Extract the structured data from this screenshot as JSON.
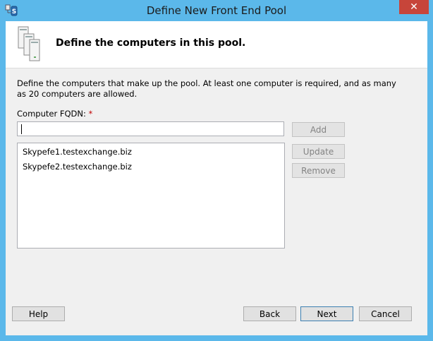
{
  "window": {
    "title": "Define New Front End Pool",
    "close_glyph": "✕"
  },
  "header": {
    "title": "Define the computers in this pool."
  },
  "body": {
    "description": "Define the computers that make up the pool. At least one computer is required, and as many as 20 computers are allowed.",
    "fqdn_label": "Computer FQDN:",
    "required_marker": "*",
    "fqdn_value": ""
  },
  "computers": [
    "Skypefe1.testexchange.biz",
    "Skypefe2.testexchange.biz"
  ],
  "buttons": {
    "add": "Add",
    "update": "Update",
    "remove": "Remove",
    "help": "Help",
    "back": "Back",
    "next": "Next",
    "cancel": "Cancel"
  },
  "colors": {
    "titlebar": "#5bb8ea",
    "close": "#c7453a",
    "required": "#c00000"
  }
}
